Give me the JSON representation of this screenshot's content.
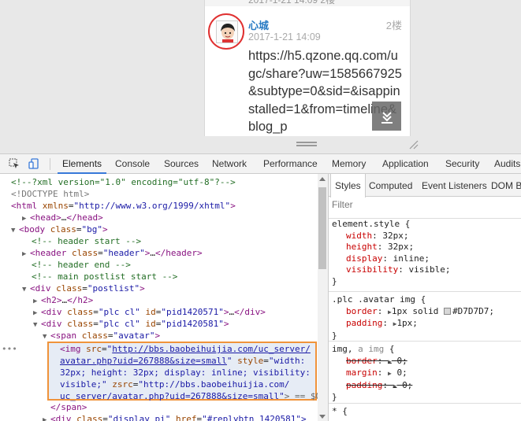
{
  "viewport": {
    "top_cut": "2017-1-21 14:09  2楼",
    "post": {
      "author": "心城",
      "floor": "2楼",
      "time": "2017-1-21 14:09",
      "content": "https://h5.qzone.qq.com/ugc/share?uw=1585667925&subtype=0&sid=&isappinstalled=1&from=timeline&blog_p"
    }
  },
  "devtools": {
    "tabs": [
      {
        "label": "Elements",
        "active": true
      },
      {
        "label": "Console"
      },
      {
        "label": "Sources"
      },
      {
        "label": "Network"
      },
      {
        "label": "Performance"
      },
      {
        "label": "Memory"
      },
      {
        "label": "Application"
      },
      {
        "label": "Security"
      },
      {
        "label": "Audits"
      }
    ],
    "tree": {
      "r1": "<!--?xml version=\"1.0\" encoding=\"utf-8\"?-->",
      "r2": "<!DOCTYPE html>",
      "r3_tag_open": "<html",
      "r3_attr": "xmlns",
      "r3_val": "\"http://www.w3.org/1999/xhtml\"",
      "r3_close": ">",
      "r4_tag": "<head>",
      "r4_dots": "…",
      "r4_end": "</head>",
      "r5_tag": "<body",
      "r5_attr": "class",
      "r5_val": "\"bg\"",
      "r6": "<!-- header start -->",
      "r7_tag": "<header",
      "r7_attr": "class",
      "r7_val": "\"header\"",
      "r7_end": "</header>",
      "r8": "<!-- header end -->",
      "r9": "<!-- main postlist start -->",
      "r10_tag": "<div",
      "r10_attr": "class",
      "r10_val": "\"postlist\"",
      "r11_tag": "<h2>",
      "r11_end": "</h2>",
      "r12_tag": "<div",
      "r12_attr": "class",
      "r12_val": "\"plc cl\"",
      "r12_attr2": "id",
      "r12_val2": "\"pid1420571\"",
      "r12_end": "</div>",
      "r13_tag": "<div",
      "r13_attr": "class",
      "r13_val": "\"plc cl\"",
      "r13_attr2": "id",
      "r13_val2": "\"pid1420581\"",
      "r14_tag": "<span",
      "r14_attr": "class",
      "r14_val": "\"avatar\"",
      "sel_l1_tag": "<img",
      "sel_l1_attr": "src",
      "sel_l1_link": "http://bbs.baobeihuijia.com/uc_server/",
      "sel_l2_link": "avatar.php?uid=267888&size=small",
      "sel_l2_attr": "style",
      "sel_l2_val": "\"width:",
      "sel_l3": "32px; height: 32px; display: inline; visibility:",
      "sel_l4_val": "visible;\"",
      "sel_l4_attr": "zsrc",
      "sel_l4_val2": "\"http://bbs.baobeihuijia.com/",
      "sel_l5_val": "uc_server/avatar.php?uid=267888&size=small\"",
      "sel_l5_end": "> == $0",
      "r20": "</span>",
      "r21_tag": "<div",
      "r21_attr": "class",
      "r21_val": "\"display pi\"",
      "r21_attr2": "href",
      "r21_link": "#replybtn_1420581",
      "r21_end": "\">"
    },
    "styles": {
      "tabs": [
        "Styles",
        "Computed",
        "Event Listeners",
        "DOM B"
      ],
      "filter_placeholder": "Filter",
      "rule1": {
        "selector": "element.style {",
        "decls": [
          {
            "p": "width",
            "v": "32px;"
          },
          {
            "p": "height",
            "v": "32px;"
          },
          {
            "p": "display",
            "v": "inline;"
          },
          {
            "p": "visibility",
            "v": "visible;"
          }
        ],
        "close": "}"
      },
      "rule2": {
        "selector": ".plc .avatar img {",
        "border_p": "border",
        "border_v1": "1px solid",
        "border_color": "#D7D7D7;",
        "padding_p": "padding",
        "padding_v": "1px;",
        "close": "}"
      },
      "rule3": {
        "selector1": "img,",
        "selector2": "a img",
        "selector_end": " {",
        "border_p": "border",
        "border_v": "0;",
        "margin_p": "margin",
        "margin_v": "0;",
        "padding_p": "padding",
        "padding_v": "0;",
        "close": "}"
      },
      "rule4": {
        "selector": "* {"
      }
    }
  }
}
